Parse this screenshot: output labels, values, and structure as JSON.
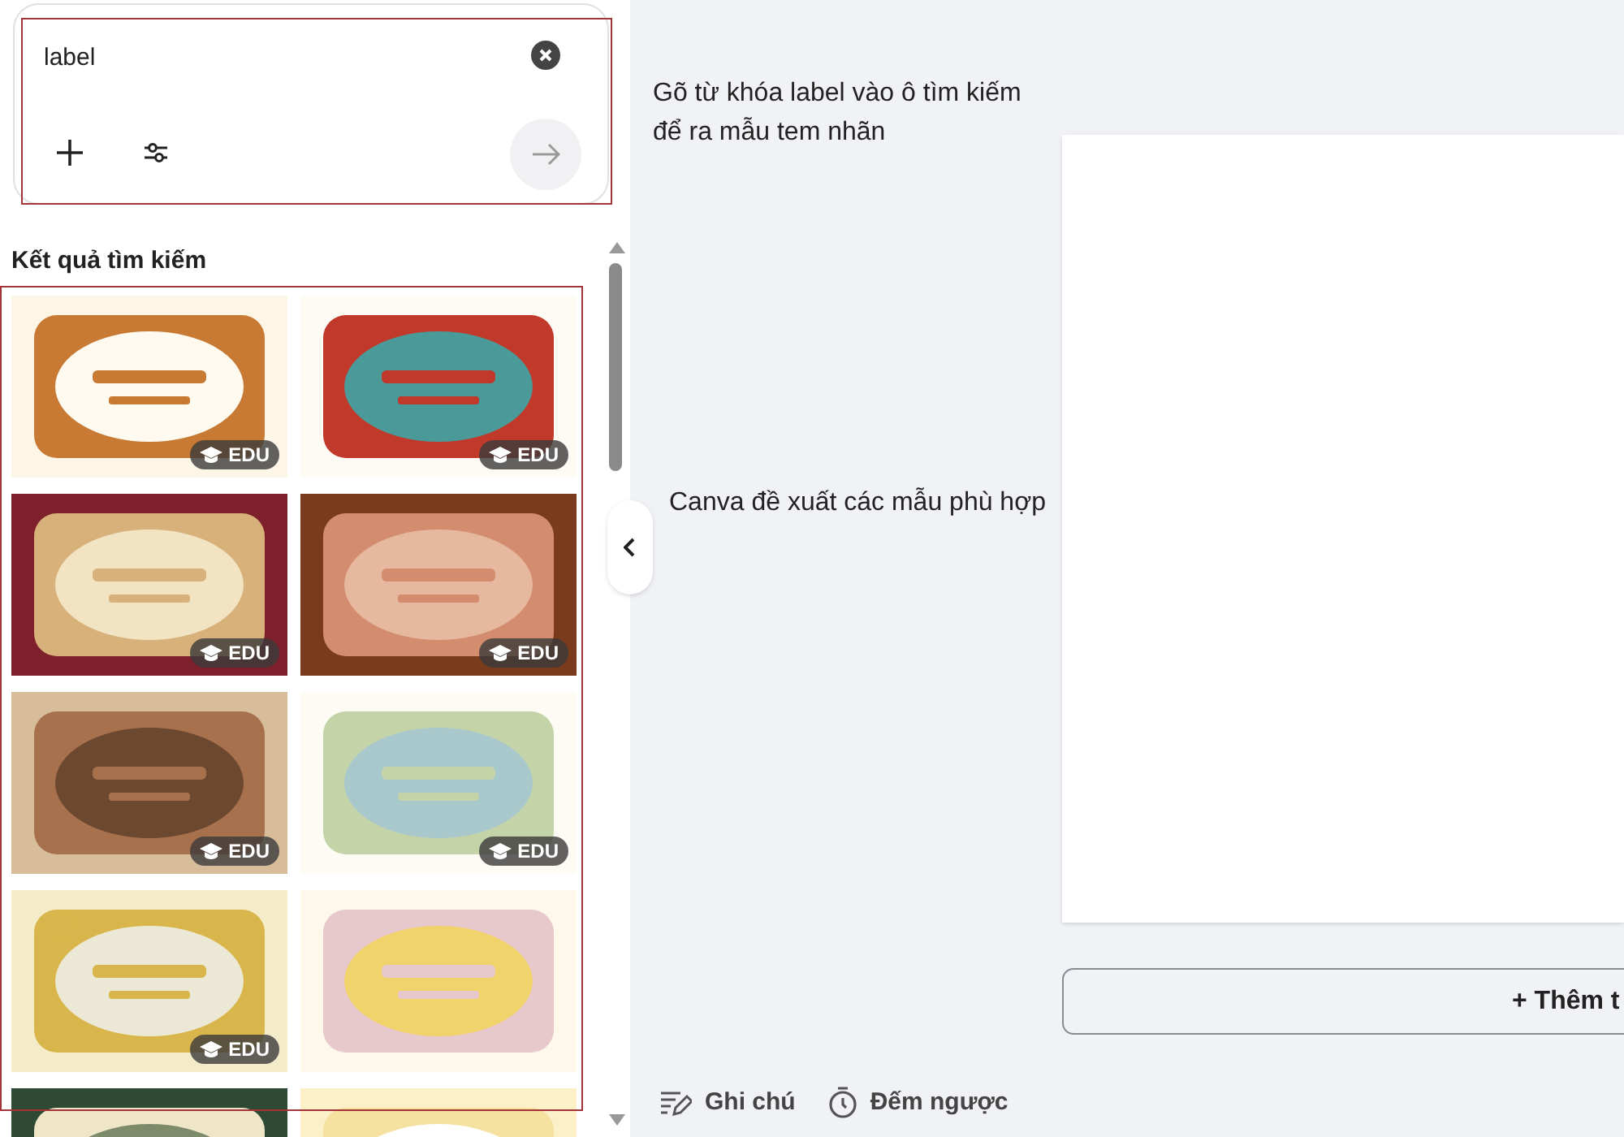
{
  "search": {
    "value": "label"
  },
  "results": {
    "title": "Kết quả tìm kiếm",
    "items": [
      {
        "kind": "picture",
        "badge": "EDU"
      },
      {
        "kind": "picture",
        "badge": "EDU"
      },
      {
        "kind": "picture",
        "badge": "EDU"
      },
      {
        "kind": "picture",
        "badge": "EDU"
      },
      {
        "kind": "picture",
        "badge": "EDU"
      },
      {
        "kind": "picture",
        "badge": "EDU"
      },
      {
        "kind": "picture",
        "badge": "EDU"
      },
      {
        "kind": "picture"
      },
      {
        "kind": "picture"
      },
      {
        "kind": "picture"
      }
    ]
  },
  "annotations": [
    "Gõ từ khóa label vào ô tìm kiếm\nđể ra mẫu tem nhãn",
    "Canva đề xuất các mẫu phù hợp"
  ],
  "add_page_button": "+ Thêm t",
  "footer": [
    {
      "kind": "notes",
      "label": "Ghi chú"
    },
    {
      "kind": "timer",
      "label": "Đếm ngược"
    }
  ]
}
